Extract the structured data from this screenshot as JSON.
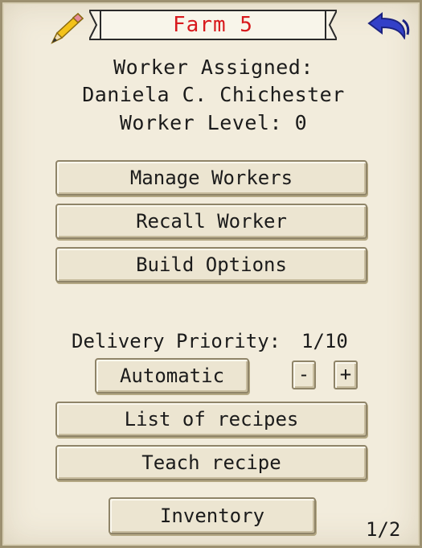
{
  "header": {
    "title": "Farm 5",
    "title_color": "#d8191d",
    "left_icon": "pencil-icon",
    "right_icon": "back-arrow-icon",
    "arrow_color": "#3340c8"
  },
  "worker": {
    "assigned_label": "Worker Assigned:",
    "name": "Daniela C. Chichester",
    "level_label": "Worker Level: 0"
  },
  "actions": {
    "manage_workers": "Manage Workers",
    "recall_worker": "Recall Worker",
    "build_options": "Build Options"
  },
  "delivery": {
    "label": "Delivery Priority:",
    "value": "1/10",
    "mode": "Automatic",
    "decrease": "-",
    "increase": "+"
  },
  "recipes": {
    "list": "List of recipes",
    "teach": "Teach recipe"
  },
  "footer": {
    "inventory": "Inventory",
    "page": "1/2"
  }
}
